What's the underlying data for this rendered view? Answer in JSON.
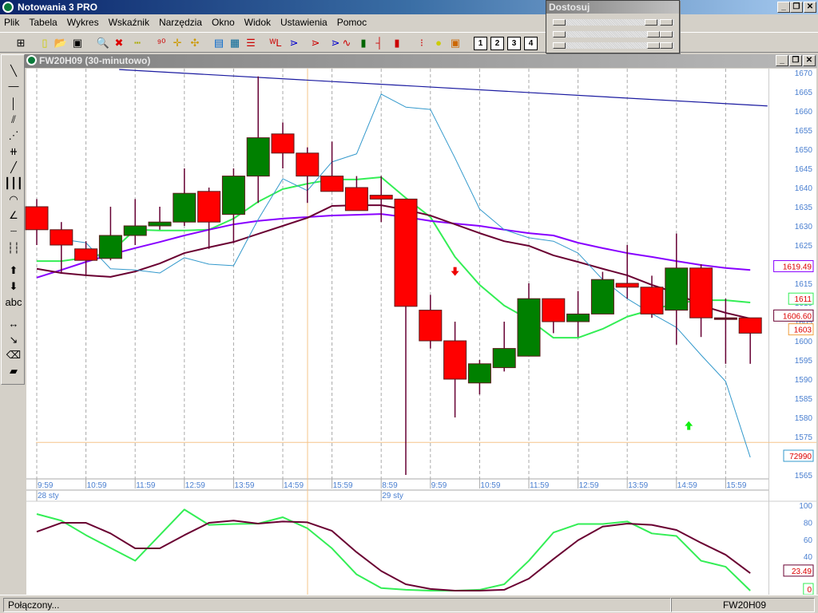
{
  "app": {
    "title": "Notowania 3 PRO"
  },
  "menu": [
    "Plik",
    "Tabela",
    "Wykres",
    "Wskaźnik",
    "Narzędzia",
    "Okno",
    "Widok",
    "Ustawienia",
    "Pomoc"
  ],
  "toolbar": {
    "icons": [
      "grid-icon",
      "new-file-icon",
      "open-folder-icon",
      "save-icon",
      "zoom-icon",
      "delete-chart-icon",
      "ruler-icon",
      "numbers-icon",
      "crosshair-icon",
      "crosshair-alt-icon",
      "table-icon",
      "color-grid-icon",
      "list-icon",
      "wl-icon",
      "arrow-blue-icon",
      "arrow-red-blue-icon",
      "arrow-blue2-icon",
      "line-chart-icon",
      "bar-chart-icon",
      "ohlc-icon",
      "candlestick-icon",
      "traffic-light-icon",
      "add-alert-icon",
      "alert-window-icon"
    ],
    "layouts": [
      "1",
      "2",
      "3",
      "4"
    ]
  },
  "adjust_panel": {
    "title": "Dostosuj"
  },
  "left_tools": [
    "line-tool-icon",
    "horizontal-line-icon",
    "vertical-line-icon",
    "channel-icon",
    "fan-icon",
    "grid-lines-icon",
    "trend-line-icon",
    "vertical-lines-icon",
    "arcs-icon",
    "angle-fan-icon",
    "horizontal-levels-icon",
    "vertical-levels-icon",
    "arrow-up-icon",
    "arrow-down-icon",
    "text-tool-icon",
    "move-icon",
    "resize-icon",
    "eraser-icon",
    "eraser-all-icon"
  ],
  "left_tools_text": "abc",
  "child": {
    "title": "FW20H09 (30-minutowo)"
  },
  "status": {
    "left": "Połączony...",
    "right": "FW20H09"
  },
  "colors": {
    "up": "#008000",
    "down": "#ff0000",
    "ma_fast": "#33ee55",
    "ma_mid": "#6a0032",
    "ma_slow": "#8800ff",
    "volume_line": "#3399cc",
    "trend": "#1a1aa0",
    "guide": "#f5c48a"
  },
  "chart_data": [
    {
      "type": "candlestick",
      "title": "FW20H09 (30-minutowo)",
      "ylim": [
        1565,
        1670
      ],
      "y_ticks": [
        "1670",
        "1665",
        "1660",
        "1655",
        "1650",
        "1645",
        "1640",
        "1635",
        "1630",
        "1625",
        "1620",
        "1615",
        "1610",
        "1605",
        "1600",
        "1595",
        "1590",
        "1585",
        "1580",
        "1575",
        "1570",
        "1565"
      ],
      "x_labels": [
        "9:59",
        "10:59",
        "11:59",
        "12:59",
        "13:59",
        "14:59",
        "15:59",
        "8:59",
        "9:59",
        "10:59",
        "11:59",
        "12:59",
        "13:59",
        "14:59",
        "15:59"
      ],
      "date_labels": [
        {
          "index": 0,
          "text": "28 sty"
        },
        {
          "index": 14,
          "text": "29 sty"
        }
      ],
      "ohlc": [
        [
          1635,
          1637,
          1625,
          1629
        ],
        [
          1629,
          1631,
          1617.5,
          1625
        ],
        [
          1624,
          1626,
          1617,
          1621
        ],
        [
          1621.5,
          1635,
          1621,
          1627.5
        ],
        [
          1627.5,
          1637,
          1625,
          1630
        ],
        [
          1630,
          1635,
          1629,
          1631
        ],
        [
          1631,
          1645,
          1630,
          1638.5
        ],
        [
          1639,
          1640,
          1624,
          1631
        ],
        [
          1633,
          1645,
          1625.5,
          1643
        ],
        [
          1643,
          1669,
          1636,
          1653
        ],
        [
          1654,
          1657,
          1645,
          1649
        ],
        [
          1649,
          1650.5,
          1636,
          1643
        ],
        [
          1643,
          1652,
          1639,
          1639
        ],
        [
          1640,
          1643,
          1634,
          1634
        ],
        [
          1638,
          1643,
          1631,
          1637
        ],
        [
          1637,
          1637,
          1565,
          1609
        ],
        [
          1608,
          1612,
          1598,
          1600
        ],
        [
          1600,
          1605,
          1580,
          1590
        ],
        [
          1589,
          1595,
          1586,
          1594
        ],
        [
          1593,
          1605,
          1592,
          1598
        ],
        [
          1596,
          1615,
          1596,
          1611
        ],
        [
          1611,
          1611,
          1602,
          1605
        ],
        [
          1605,
          1613,
          1601,
          1607
        ],
        [
          1607,
          1618,
          1607,
          1616
        ],
        [
          1615,
          1625,
          1611,
          1614
        ],
        [
          1614,
          1617,
          1606,
          1607
        ],
        [
          1608,
          1628,
          1599,
          1619
        ],
        [
          1619,
          1620,
          1601,
          1606
        ],
        [
          1606,
          1611,
          1594,
          1606
        ],
        [
          1606,
          1606,
          1594,
          1602
        ]
      ],
      "series": [
        {
          "name": "ma_fast",
          "color": "#33ee55",
          "width": 2,
          "values": [
            1620.8,
            1620.8,
            1621.7,
            1623.1,
            1629.0,
            1628.8,
            1628.8,
            1629.0,
            1631.9,
            1636.3,
            1639.6,
            1641.0,
            1642.1,
            1642.1,
            1642.7,
            1637.3,
            1632.3,
            1621.9,
            1614.6,
            1609.2,
            1605.6,
            1600.8,
            1600.8,
            1603.1,
            1606.3,
            1608.1,
            1609.8,
            1610.6,
            1610.6,
            1610.0
          ]
        },
        {
          "name": "ma_slow",
          "color": "#8800ff",
          "width": 2,
          "values": [
            1616.5,
            1618.5,
            1620.6,
            1622.5,
            1624.2,
            1625.8,
            1627.5,
            1629.0,
            1630.4,
            1631.3,
            1631.9,
            1632.3,
            1632.7,
            1632.9,
            1633.1,
            1632.3,
            1631.3,
            1630.6,
            1630.0,
            1629.0,
            1628.1,
            1627.5,
            1625.6,
            1624.2,
            1622.9,
            1621.9,
            1620.8,
            1619.8,
            1619.0,
            1618.5
          ]
        },
        {
          "name": "ma_mid",
          "color": "#6a0032",
          "width": 2,
          "values": [
            1618.8,
            1617.7,
            1617.1,
            1616.7,
            1618.1,
            1620.2,
            1622.9,
            1624.4,
            1625.8,
            1627.9,
            1630.0,
            1632.1,
            1635.2,
            1635.4,
            1635.4,
            1634.2,
            1632.7,
            1630.4,
            1628.1,
            1626.0,
            1624.8,
            1622.3,
            1620.6,
            1618.8,
            1617.1,
            1614.6,
            1612.5,
            1609.2,
            1607.3,
            1605.8
          ]
        },
        {
          "name": "volume_line",
          "color": "#3399cc",
          "width": 1,
          "start": 1,
          "values": [
            1626.5,
            1625.6,
            1618.8,
            1618.5,
            1617.7,
            1621.7,
            1620.0,
            1619.6,
            1631.7,
            1642.3,
            1639.2,
            1646.7,
            1648.8,
            1664.4,
            1661.0,
            1660.4,
            1647.7,
            1634.4,
            1629.0,
            1626.9,
            1626.0,
            1622.9,
            1616.0,
            1611.0,
            1607.1,
            1603.5,
            1596.3,
            1589.4,
            1569.6
          ]
        }
      ],
      "trend_line": {
        "from": {
          "index": 3.35,
          "price": 1670.8
        },
        "to": {
          "index": 29.7,
          "price": 1661.3
        }
      },
      "horizontal_line": 1573.5,
      "signals": [
        {
          "type": "sell",
          "index": 17,
          "price": 1618
        },
        {
          "type": "buy",
          "index": 26.5,
          "price": 1578
        }
      ],
      "value_labels": [
        {
          "text": "1619.49",
          "border": "#8800ff",
          "price": 1619.49
        },
        {
          "text": "1611",
          "border": "#33ee55",
          "price": 1611
        },
        {
          "text": "1606.60",
          "border": "#6a0032",
          "price": 1606.6
        },
        {
          "text": "1603",
          "border": "#f0a040",
          "price": 1603
        },
        {
          "text": "72990",
          "border": "#3399cc",
          "price": 1570
        }
      ]
    },
    {
      "type": "line",
      "title": "Stochastic",
      "ylim": [
        0,
        100
      ],
      "y_ticks": [
        "100",
        "80",
        "60",
        "40"
      ],
      "series": [
        {
          "name": "%K",
          "color": "#33ee55",
          "values": [
            89.7,
            82,
            65,
            50,
            35,
            65,
            95,
            77,
            78,
            78.5,
            86,
            73,
            49.5,
            19,
            3,
            1,
            0,
            0,
            1,
            7.5,
            35,
            68,
            78,
            78,
            81,
            67,
            64,
            35,
            28,
            0
          ]
        },
        {
          "name": "%D",
          "color": "#6a0032",
          "values": [
            69,
            79.4,
            79.4,
            67,
            49.5,
            49.5,
            65,
            79.4,
            82,
            78.5,
            81,
            80,
            70,
            45,
            23,
            7.5,
            2,
            0,
            0,
            1,
            14,
            37,
            59,
            75,
            78.5,
            77,
            71,
            56,
            42,
            20.5
          ]
        }
      ],
      "value_labels": [
        {
          "text": "23.49",
          "border": "#6a0032",
          "value": 23.49
        },
        {
          "text": "0",
          "border": "#33ee55",
          "value": 0
        }
      ]
    }
  ]
}
